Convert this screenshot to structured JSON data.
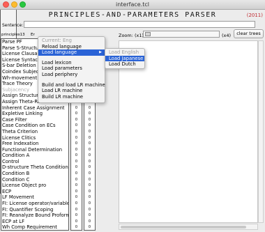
{
  "window": {
    "title": "interface.tcl"
  },
  "app": {
    "title": "PRINCIPLES-AND-PARAMETERS PARSER",
    "year": "(2011)"
  },
  "sentence": {
    "label": "Sentence:",
    "value": ""
  },
  "zoom": {
    "label": "Zoom: (x1)",
    "max_label": "(x4)",
    "level": 0.0
  },
  "toolbar": {
    "clear_trees": "clear trees"
  },
  "list_header": {
    "principles": "principles13",
    "col": "Er"
  },
  "principles": [
    "Parse PF",
    "Parse S-Structure",
    "License Clausal",
    "License Syntactic",
    "S-bar Deletion",
    "Coindex Subject",
    "Wh-movement",
    "Trace Theory",
    "Subjacency",
    "Assign Structural",
    "Assign Theta-Roles",
    "Inherent Case Assignment",
    "Expletive Linking",
    "Case Filter",
    "Case Condition on ECs",
    "Theta Criterion",
    "License Clitics",
    "Free Indexation",
    "Functional Determination",
    "Condition A",
    "Control",
    "D-structure Theta Condition",
    "Condition B",
    "Condition C",
    "License Object pro",
    "ECP",
    "LF Movement",
    "FI: License operator/variables",
    "FI: Quantifier Scoping",
    "FI: Reanalyze Bound Proforms",
    "ECP at LF",
    "Wh Comp Requirement"
  ],
  "col1_values": [
    "0",
    "0",
    "0",
    "0",
    "0",
    "0",
    "0",
    "0",
    "0",
    "0",
    "0",
    "0",
    "0",
    "0",
    "0",
    "0",
    "0",
    "0",
    "0",
    "0",
    "0",
    "0",
    "0",
    "0",
    "0",
    "0",
    "0"
  ],
  "col2_values": [
    "0",
    "0",
    "0",
    "0",
    "0",
    "0",
    "0",
    "0",
    "0",
    "0",
    "0",
    "0",
    "0",
    "0",
    "0",
    "0",
    "0",
    "0",
    "0",
    "0",
    "0",
    "0",
    "0",
    "0",
    "0",
    "0",
    "0"
  ],
  "menu": {
    "current": "Current: Eng",
    "reload_language": "Reload language",
    "load_language": "Load language",
    "load_lexicon": "Load lexicon",
    "load_parameters": "Load parameters",
    "load_periphery": "Load periphery",
    "build_and_load_lr": "Build and load LR machine",
    "load_lr": "Load LR machine",
    "build_lr": "Build LR machine"
  },
  "submenu": {
    "load_english": "Load English",
    "load_japanese": "Load Japanese",
    "load_dutch": "Load Dutch"
  },
  "colors": {
    "highlight": "#2a63d6",
    "year": "#c0282f"
  }
}
